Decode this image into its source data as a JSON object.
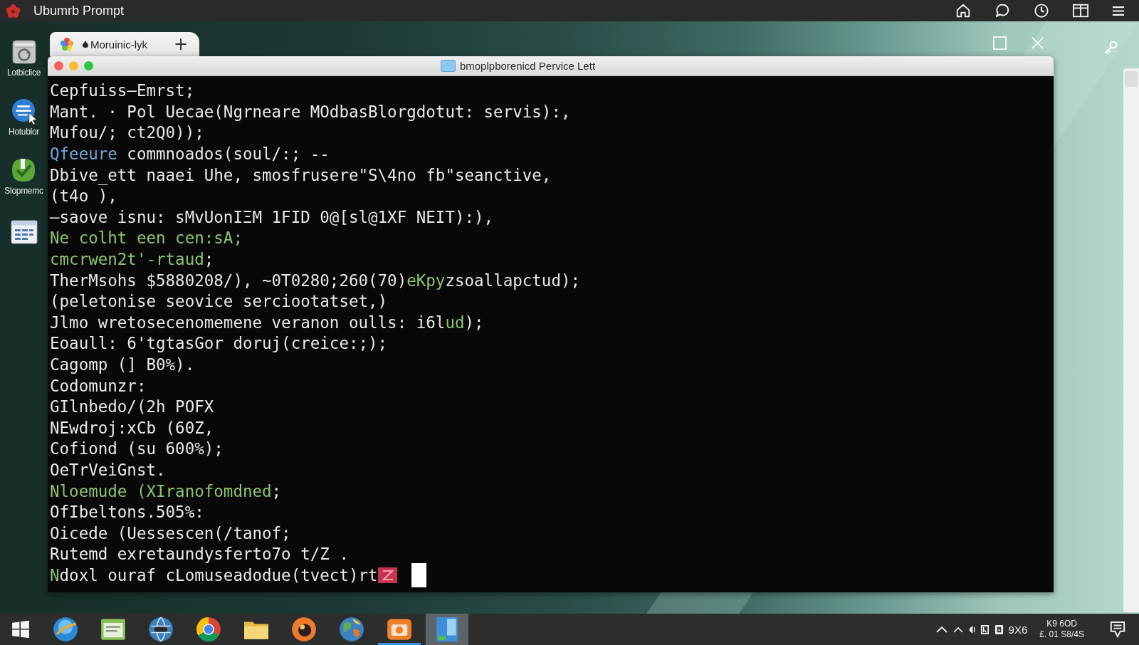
{
  "top_bar": {
    "title": "Ubumrb Prompt"
  },
  "desktop_icons": [
    {
      "label": "Lotbiclice"
    },
    {
      "label": "Hotublor"
    },
    {
      "label": "Slopmemc"
    }
  ],
  "tab": {
    "title": "Moruinic-lyk",
    "new_tab": "+"
  },
  "terminal_window": {
    "title": "bmoplpborenicd Pervice Lett",
    "lines": [
      {
        "segments": [
          {
            "text": "Cepfuiss—Emrst;",
            "color": "#e8e8e8"
          }
        ]
      },
      {
        "segments": [
          {
            "text": "Mant. · Pol Uecae(Ngrneare MOdbasBlorgdotut: servis):,",
            "color": "#e8e8e8"
          }
        ]
      },
      {
        "segments": [
          {
            "text": "Mufou/; ct2Q0));",
            "color": "#e8e8e8"
          }
        ]
      },
      {
        "segments": [
          {
            "text": "Qfeeure",
            "color": "#6fa6da"
          },
          {
            "text": " commnoados(soul/:; --",
            "color": "#e8e8e8"
          }
        ]
      },
      {
        "segments": [
          {
            "text": "Dbive_ett naaei Uhe, smosfrusere\"S\\4no fb\"seanctive,",
            "color": "#e8e8e8"
          }
        ]
      },
      {
        "segments": [
          {
            "text": "(t4o ),",
            "color": "#e8e8e8"
          }
        ]
      },
      {
        "segments": [
          {
            "text": "—saove isnu: sMvUonIΞM 1FID 0@[sl@1XF NEIT):),",
            "color": "#e8e8e8"
          }
        ]
      },
      {
        "segments": [
          {
            "text": "Ne colht een cen:sA;",
            "color": "#8cc56f"
          }
        ]
      },
      {
        "segments": [
          {
            "text": "cmcrwen2t'-rtaud",
            "color": "#8cc56f"
          },
          {
            "text": ";",
            "color": "#e8e8e8"
          }
        ]
      },
      {
        "segments": [
          {
            "text": "TherMsohs $5880208/), ~0T0280;260(70)",
            "color": "#e8e8e8"
          },
          {
            "text": "eKpy",
            "color": "#8cc56f"
          },
          {
            "text": "zsoallapctud);",
            "color": "#e8e8e8"
          }
        ]
      },
      {
        "segments": [
          {
            "text": "(peletonise seovice serciootatset,)",
            "color": "#e8e8e8"
          }
        ]
      },
      {
        "segments": [
          {
            "text": "Jlmo wretosecenomemene veranon oulls: i6l",
            "color": "#e8e8e8"
          },
          {
            "text": "ud",
            "color": "#8cc56f"
          },
          {
            "text": ");",
            "color": "#e8e8e8"
          }
        ]
      },
      {
        "segments": [
          {
            "text": "Eoaull: 6'tgtasGor doruj(creice:;);",
            "color": "#e8e8e8"
          }
        ]
      },
      {
        "segments": [
          {
            "text": "Cagomp (] B0%).",
            "color": "#e8e8e8"
          }
        ]
      },
      {
        "segments": [
          {
            "text": "Codomunzr:",
            "color": "#e8e8e8"
          }
        ]
      },
      {
        "segments": [
          {
            "text": "GIlnbedo/(2h POFX",
            "color": "#e8e8e8"
          }
        ]
      },
      {
        "segments": [
          {
            "text": "NEwdroj:xCb (60Z,",
            "color": "#e8e8e8"
          }
        ]
      },
      {
        "segments": [
          {
            "text": "Cofiond (su 600%);",
            "color": "#e8e8e8"
          }
        ]
      },
      {
        "segments": [
          {
            "text": "OeTrVeiGnst.",
            "color": "#e8e8e8"
          }
        ]
      },
      {
        "segments": [
          {
            "text": "Nloemude (XIranofomdned",
            "color": "#8cc56f"
          },
          {
            "text": ";",
            "color": "#e8e8e8"
          }
        ]
      },
      {
        "segments": [
          {
            "text": "OfIbeltons.505%:",
            "color": "#e8e8e8"
          }
        ]
      },
      {
        "segments": [
          {
            "text": "Oicede (Uessescen(/tanof;",
            "color": "#e8e8e8"
          }
        ]
      },
      {
        "segments": [
          {
            "text": "Rutemd exretaundysferto7o t/Z .",
            "color": "#e8e8e8"
          }
        ]
      },
      {
        "segments": [
          {
            "text": "N",
            "color": "#8cc56f"
          },
          {
            "text": "doxl ouraf cLomuseadodue(tvect)rt",
            "color": "#e8e8e8"
          }
        ]
      }
    ]
  },
  "taskbar": {
    "items": [
      {
        "selected": false,
        "running": false
      },
      {
        "selected": false,
        "running": false
      },
      {
        "selected": false,
        "running": false
      },
      {
        "selected": false,
        "running": false
      },
      {
        "selected": false,
        "running": false
      },
      {
        "selected": false,
        "running": false
      },
      {
        "selected": false,
        "running": false
      },
      {
        "selected": false,
        "running": true
      },
      {
        "selected": true,
        "running": false
      }
    ],
    "tray_text": "9X6",
    "clock": {
      "time": "K9 6OD",
      "date": "£. 01 S8/4S"
    }
  }
}
